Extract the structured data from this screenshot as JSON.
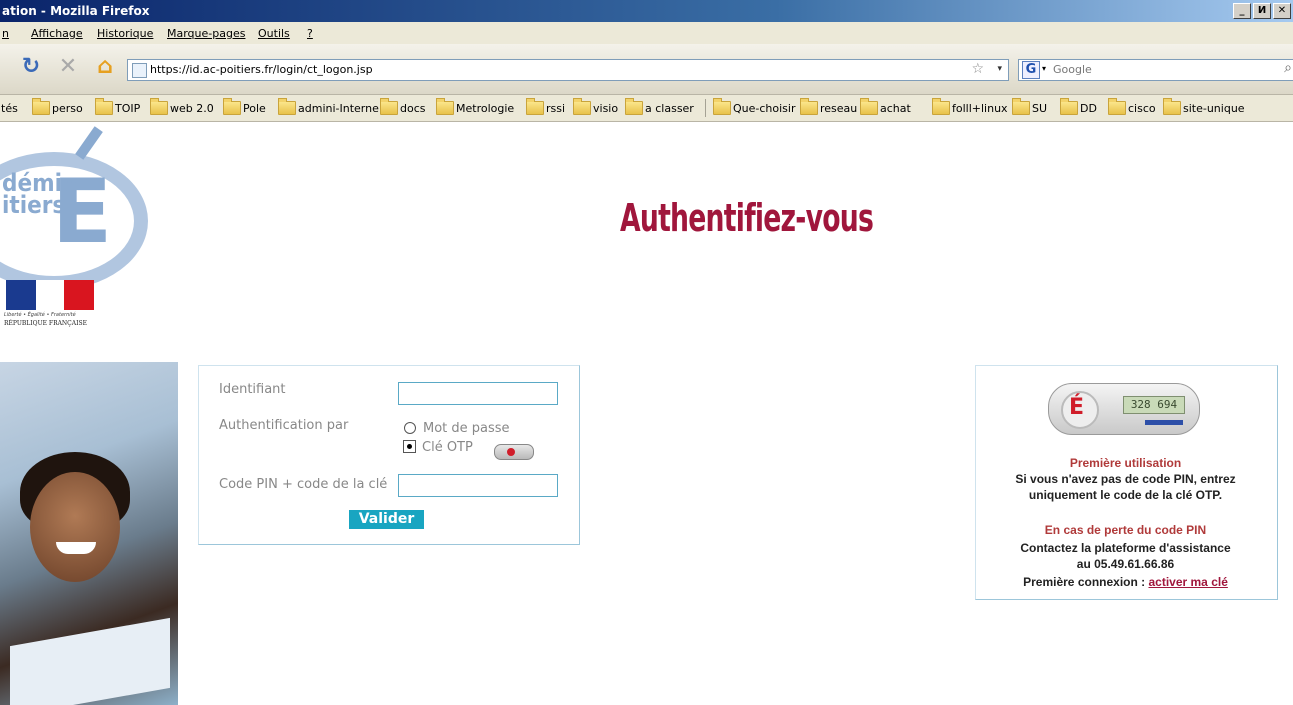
{
  "window": {
    "title": "ation - Mozilla Firefox",
    "controls": [
      "_",
      "И",
      "✕"
    ]
  },
  "menu": {
    "items": [
      "n",
      "Affichage",
      "Historique",
      "Marque-pages",
      "Outils",
      "?"
    ]
  },
  "nav": {
    "url": "https://id.ac-poitiers.fr/login/ct_logon.jsp",
    "search_placeholder": "Google"
  },
  "bookmarks": {
    "items": [
      "tés",
      "perso",
      "TOIP",
      "web 2.0",
      "Pole",
      "admini-Interne",
      "docs",
      "Metrologie",
      "rssi",
      "visio",
      "a classer",
      "Que-choisir",
      "reseau",
      "achat",
      "folll+linux",
      "SU",
      "DD",
      "cisco",
      "site-unique"
    ]
  },
  "sidebar": {
    "logo_line1": "démie",
    "logo_line2": "itiers",
    "motto": "Liberté • Égalité • Fraternité",
    "republic": "RÉPUBLIQUE FRANÇAISE"
  },
  "page": {
    "heading": "Authentifiez-vous"
  },
  "form": {
    "identifiant_label": "Identifiant",
    "identifiant_value": "",
    "auth_label": "Authentification par",
    "option_password": "Mot de passe",
    "option_otp": "Clé OTP",
    "selected_option": "Clé OTP",
    "pin_label": "Code PIN + code de la clé",
    "pin_value": "",
    "submit_label": "Valider"
  },
  "info": {
    "token_display": "328 694",
    "first_use_title": "Première utilisation",
    "first_use_text1": "Si vous n'avez pas de code PIN, entrez",
    "first_use_text2": "uniquement le code de la clé OTP.",
    "lost_pin_title": "En cas de perte du code PIN",
    "contact_text": "Contactez la plateforme d'assistance",
    "phone_text": "au 05.49.61.66.86",
    "first_conn_label": "Première connexion : ",
    "activate_link": "activer ma clé"
  }
}
